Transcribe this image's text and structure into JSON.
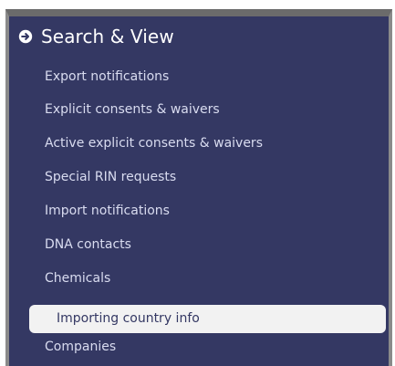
{
  "section": {
    "title": "Search & View",
    "icon": "arrow-right-circle-icon"
  },
  "menu": {
    "items": [
      {
        "label": "Export notifications",
        "active": false
      },
      {
        "label": "Explicit consents & waivers",
        "active": false
      },
      {
        "label": "Active explicit consents & waivers",
        "active": false
      },
      {
        "label": "Special RIN requests",
        "active": false
      },
      {
        "label": "Import notifications",
        "active": false
      },
      {
        "label": "DNA contacts",
        "active": false
      },
      {
        "label": "Chemicals",
        "active": false
      },
      {
        "label": "Importing country info",
        "active": true
      },
      {
        "label": "Companies",
        "active": false
      }
    ]
  },
  "colors": {
    "panel_background": "#343863",
    "panel_border": "#8a8a8a",
    "item_text": "#d9dcf0",
    "active_background": "#f2f2f2",
    "active_text": "#343863"
  }
}
